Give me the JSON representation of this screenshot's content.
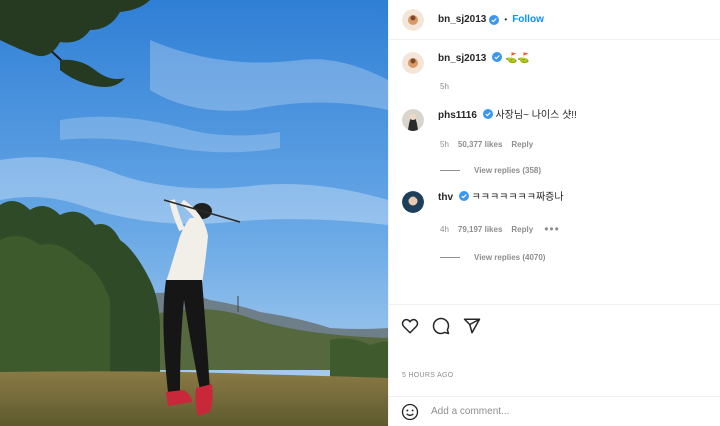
{
  "header": {
    "username": "bn_sj2013",
    "separator": "•",
    "follow_label": "Follow"
  },
  "caption": {
    "username": "bn_sj2013",
    "text": "⛳⛳",
    "time": "5h"
  },
  "comments": [
    {
      "username": "phs1116",
      "text": "사장님~ 나이스 샷!!",
      "time": "5h",
      "likes": "50,377 likes",
      "reply_label": "Reply",
      "view_replies": "View replies (358)"
    },
    {
      "username": "thv",
      "text": "ㅋㅋㅋㅋㅋㅋㅋ짜증나",
      "time": "4h",
      "likes": "79,197 likes",
      "reply_label": "Reply",
      "more": "•••",
      "view_replies": "View replies (4070)"
    }
  ],
  "actions": {
    "icons": [
      "heart-icon",
      "comment-icon",
      "share-icon"
    ]
  },
  "timestamp": "5 HOURS AGO",
  "add_comment": {
    "placeholder": "Add a comment..."
  },
  "colors": {
    "accent": "#0095f6",
    "verified": "#3897f0",
    "muted": "#8e8e8e",
    "text": "#262626"
  }
}
